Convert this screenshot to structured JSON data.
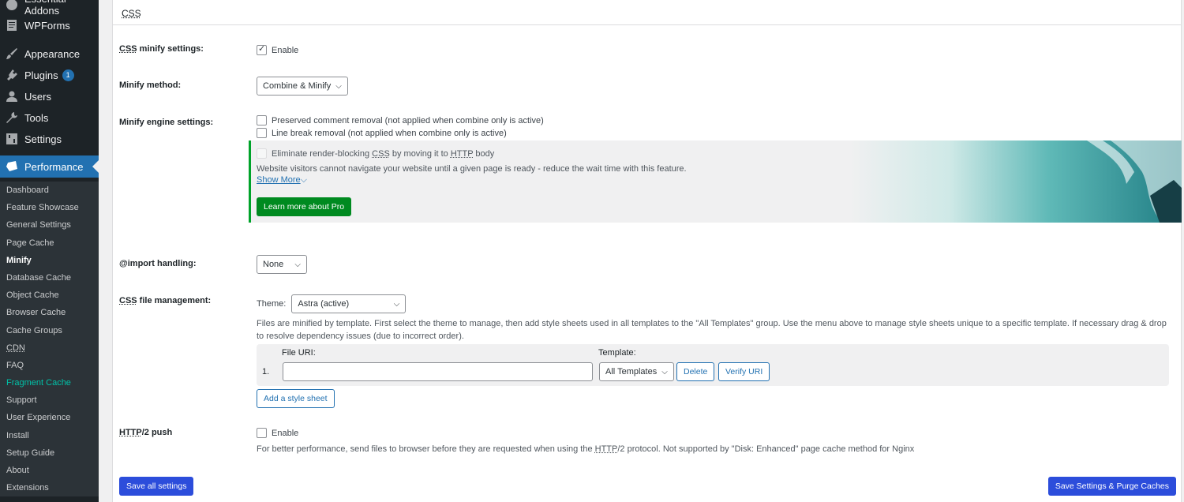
{
  "sidebar": {
    "menu": [
      {
        "label": "Essential Addons",
        "icon": "essential-addons-icon",
        "badge": ""
      },
      {
        "label": "WPForms",
        "icon": "wpforms-icon",
        "badge": ""
      },
      {
        "label": "Appearance",
        "icon": "paintbrush-icon",
        "badge": ""
      },
      {
        "label": "Plugins",
        "icon": "plugin-icon",
        "badge": "1"
      },
      {
        "label": "Users",
        "icon": "user-icon",
        "badge": ""
      },
      {
        "label": "Tools",
        "icon": "wrench-icon",
        "badge": ""
      },
      {
        "label": "Settings",
        "icon": "settings-icon",
        "badge": ""
      },
      {
        "label": "Performance",
        "icon": "performance-icon",
        "badge": ""
      }
    ],
    "submenu": [
      "Dashboard",
      "Feature Showcase",
      "General Settings",
      "Page Cache",
      "Minify",
      "Database Cache",
      "Object Cache",
      "Browser Cache",
      "Cache Groups",
      "CDN",
      "FAQ",
      "Fragment Cache",
      "Support",
      "User Experience",
      "Install",
      "Setup Guide",
      "About",
      "Extensions"
    ],
    "current_sub": "Minify"
  },
  "panel": {
    "title": "CSS",
    "minify_settings": {
      "label_abbr": "CSS",
      "label_rest": " minify settings:",
      "option": "Enable"
    },
    "minify_method": {
      "label": "Minify method:",
      "value": "Combine & Minify"
    },
    "engine": {
      "label": "Minify engine settings:",
      "opt1": "Preserved comment removal (not applied when combine only is active)",
      "opt2": "Line break removal (not applied when combine only is active)"
    },
    "pro": {
      "opt_prefix": "Eliminate render-blocking ",
      "opt_abbr1": "CSS",
      "opt_middle": " by moving it to ",
      "opt_abbr2": "HTTP",
      "opt_suffix": " body",
      "desc": "Website visitors cannot navigate your website until a given page is ready - reduce the wait time with this feature.",
      "show_more": "Show More",
      "button": "Learn more about Pro"
    },
    "import": {
      "label": "@import handling:",
      "value": "None"
    },
    "file_mgmt": {
      "label_abbr": "CSS",
      "label_rest": " file management:",
      "theme_label": "Theme:",
      "theme_value": "Astra (active)",
      "desc1": "Files are minified by template. First select the theme to manage, then add style sheets used in all templates to the \"All Templates\" group. Use the menu above to manage style sheets unique to a specific template. If necessary drag & drop",
      "desc2": "to resolve dependency issues (due to incorrect order).",
      "col_uri": "File URI:",
      "col_template": "Template:",
      "row_num": "1.",
      "row_uri": "",
      "row_template": "All Templates",
      "delete_btn": "Delete",
      "verify_btn": "Verify URI",
      "add_btn": "Add a style sheet"
    },
    "http2": {
      "label_abbr": "HTTP",
      "label_rest": "/2 push",
      "option": "Enable",
      "desc_prefix": "For better performance, send files to browser before they are requested when using the ",
      "desc_abbr": "HTTP",
      "desc_suffix": "/2 protocol. Not supported by \"Disk: Enhanced\" page cache method for Nginx"
    },
    "save_all": "Save all settings",
    "save_purge": "Save Settings & Purge Caches"
  }
}
